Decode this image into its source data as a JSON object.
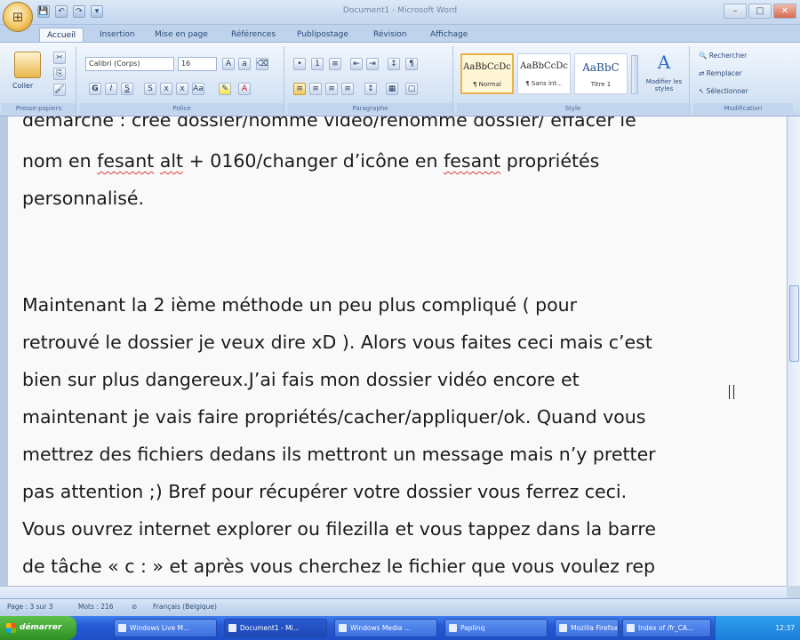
{
  "window": {
    "title": "Document1 - Microsoft Word",
    "office_button_glyph": "⊞",
    "quick_access": [
      "💾",
      "↶",
      "↷",
      "▾"
    ],
    "controls": [
      "–",
      "□",
      "✕"
    ]
  },
  "tabs": [
    {
      "label": "Accueil",
      "active": true
    },
    {
      "label": "Insertion",
      "active": false
    },
    {
      "label": "Mise en page",
      "active": false
    },
    {
      "label": "Références",
      "active": false
    },
    {
      "label": "Publipostage",
      "active": false
    },
    {
      "label": "Révision",
      "active": false
    },
    {
      "label": "Affichage",
      "active": false
    }
  ],
  "ribbon": {
    "clipboard": {
      "label": "Presse-papiers",
      "paste": "Coller"
    },
    "font": {
      "label": "Police",
      "family": "Calibri (Corps)",
      "size": "16",
      "bold": "G",
      "italic": "I",
      "underline": "S"
    },
    "paragraph": {
      "label": "Paragraphe"
    },
    "styles": {
      "label": "Style",
      "items": [
        {
          "sample": "AaBbCcDc",
          "name": "¶ Normal",
          "selected": true
        },
        {
          "sample": "AaBbCcDc",
          "name": "¶ Sans int...",
          "selected": false
        },
        {
          "sample": "AaBbC",
          "name": "Titre 1",
          "selected": false
        }
      ],
      "change": "Modifier les styles"
    },
    "editing": {
      "label": "Modification",
      "find": "Rechercher",
      "replace": "Remplacer",
      "select": "Sélectionner"
    }
  },
  "document": {
    "lines": [
      "démarche : crée dossier/nomme vidéo/renomme dossier/ effacer le",
      "nom en fesant alt + 0160/changer d’icône en fesant propriétés",
      "personnalisé.",
      "",
      "Maintenant la 2 ième méthode un peu plus compliqué ( pour",
      "retrouvé le dossier je veux dire xD ). Alors vous faites ceci mais c’est",
      "bien sur plus dangereux.J’ai fais mon dossier vidéo encore et",
      "maintenant je vais faire propriétés/cacher/appliquer/ok. Quand vous",
      "mettrez des fichiers dedans ils mettront un message mais n’y pretter",
      "pas attention ;) Bref pour récupérer votre dossier vous ferrez ceci.",
      "Vous ouvrez internet explorer ou filezilla et vous tappez dans la barre",
      "de tâche  « c : » et après vous cherchez le fichier que vous voulez rep"
    ]
  },
  "status": {
    "page": "Page : 3 sur 3",
    "words": "Mots : 216",
    "language": "Français (Belgique)"
  },
  "taskbar": {
    "start": "démarrer",
    "tasks": [
      "Windows Live M...",
      "Document1 - Mi...",
      "Windows Media ...",
      "Paplinq",
      "Mozilla Firefox",
      "Index of /fr_CA..."
    ],
    "clock": "12:37"
  }
}
